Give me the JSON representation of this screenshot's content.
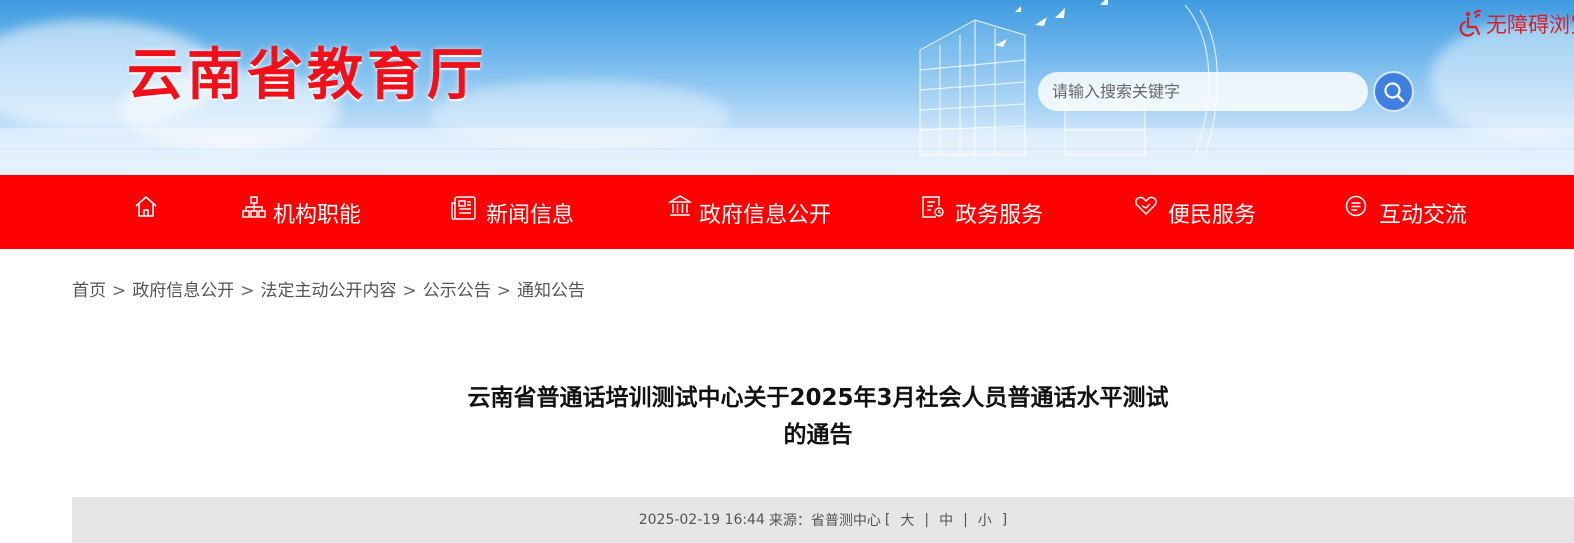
{
  "header": {
    "site_title": "云南省教育厅",
    "accessibility_label": "无障碍浏览",
    "search_placeholder": "请输入搜索关键字"
  },
  "nav": {
    "items": [
      {
        "label": "",
        "icon": "home-icon"
      },
      {
        "label": "机构职能",
        "icon": "org-chart-icon"
      },
      {
        "label": "新闻信息",
        "icon": "newspaper-icon"
      },
      {
        "label": "政府信息公开",
        "icon": "government-building-icon"
      },
      {
        "label": "政务服务",
        "icon": "service-document-icon"
      },
      {
        "label": "便民服务",
        "icon": "heart-hand-icon"
      },
      {
        "label": "互动交流",
        "icon": "chat-bubble-icon"
      }
    ]
  },
  "breadcrumb": {
    "items": [
      "首页",
      "政府信息公开",
      "法定主动公开内容",
      "公示公告",
      "通知公告"
    ],
    "separator": ">"
  },
  "article": {
    "title_line1": "云南省普通话培训测试中心关于2025年3月社会人员普通话水平测试",
    "title_line2": "的通告",
    "date": "2025-02-19 16:44",
    "source_label": "来源：",
    "source": "省普测中心",
    "font_size_open": "[",
    "font_size_large": "大",
    "font_size_medium": "中",
    "font_size_small": "小",
    "font_size_divider": "|",
    "font_size_close": "]"
  },
  "colors": {
    "brand_red": "#ff0000",
    "title_red": "#f1101a",
    "search_blue": "#3f7fe0",
    "meta_bg": "#e6e6e6"
  }
}
